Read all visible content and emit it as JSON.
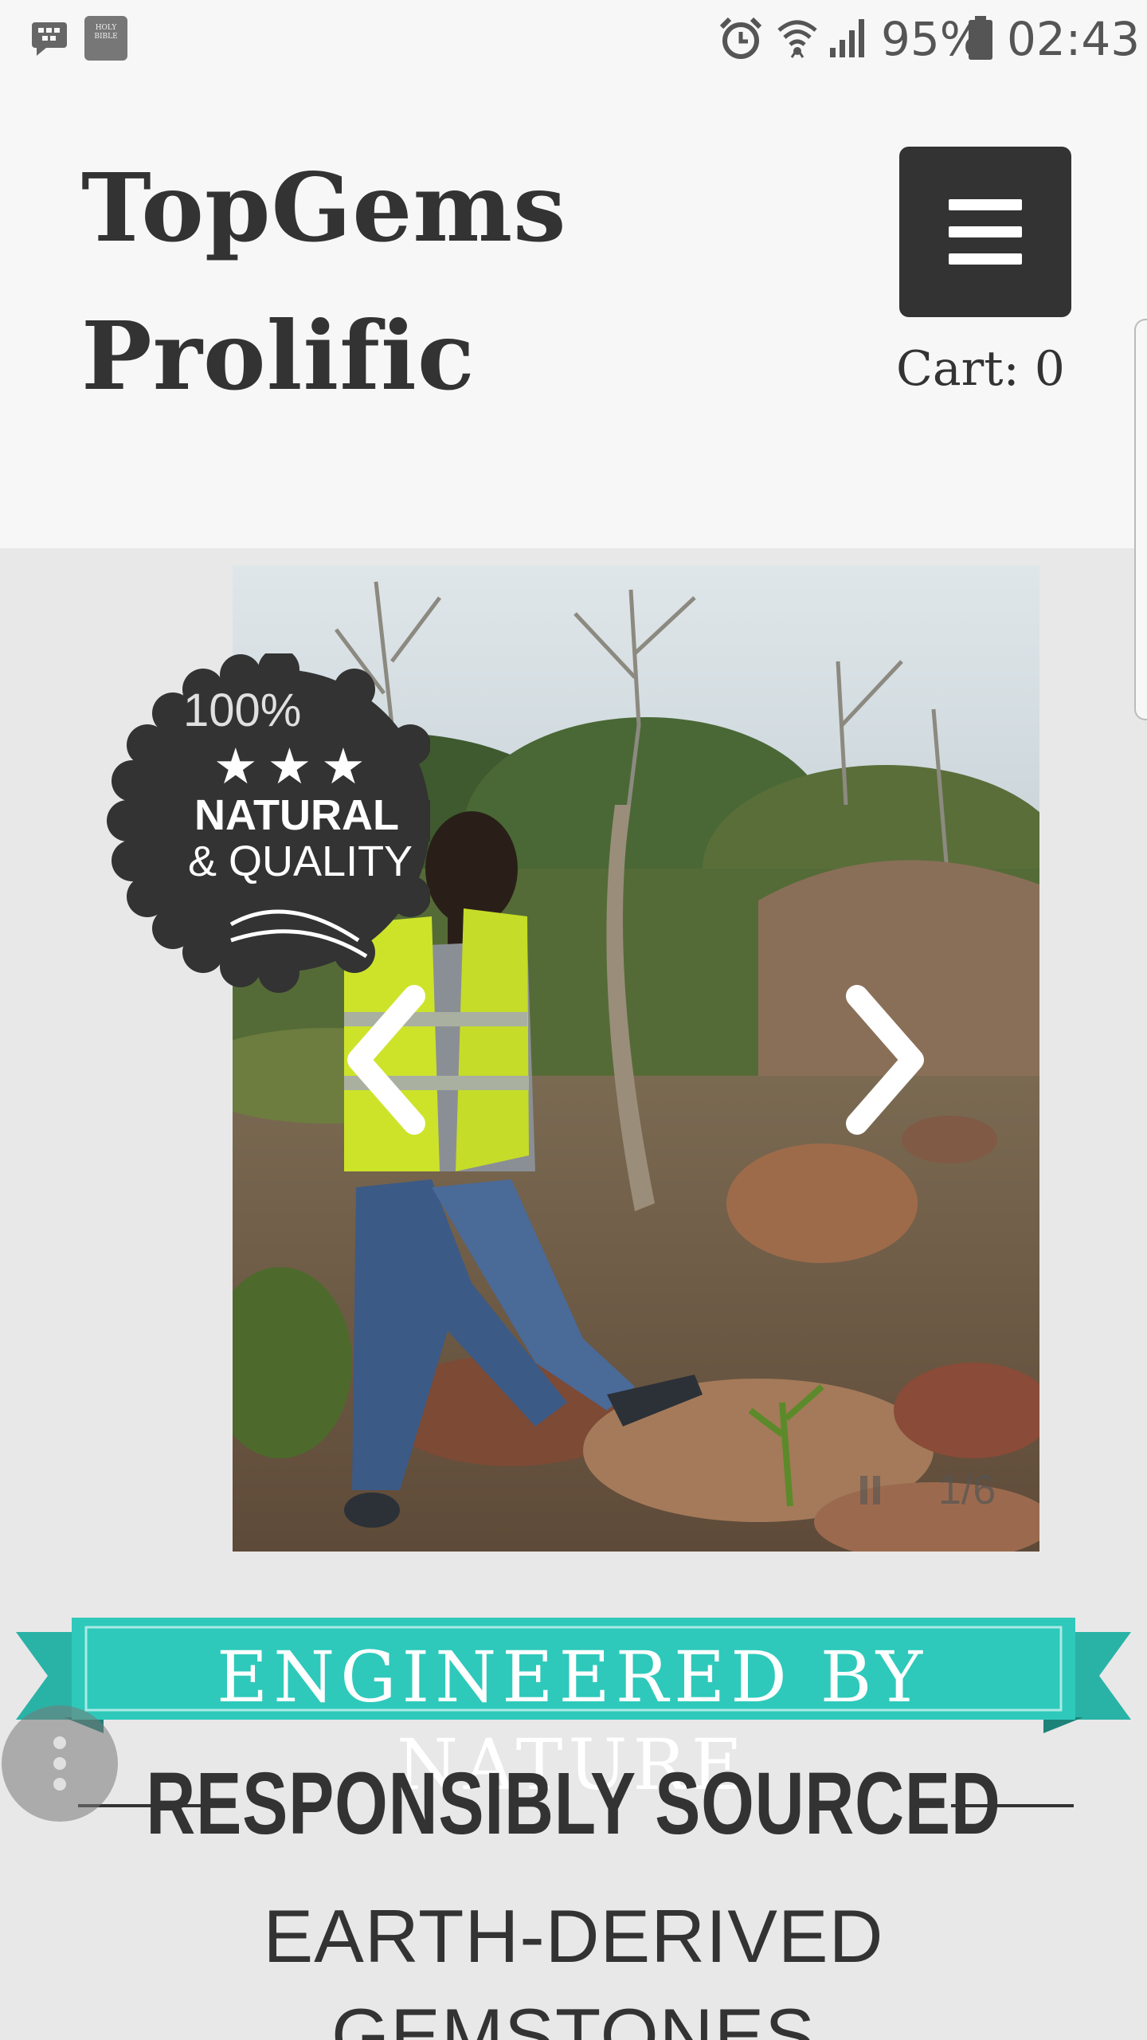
{
  "status_bar": {
    "battery": "95%",
    "time": "02:43",
    "icons": [
      "bbm-icon",
      "bible-app-icon",
      "alarm-icon",
      "wifi-icon",
      "signal-icon",
      "battery-icon"
    ],
    "bible_icon_text": "HOLY BIBLE"
  },
  "header": {
    "title": "TopGems Prolific",
    "cart": "Cart: 0",
    "menu_icon": "hamburger-icon"
  },
  "slideshow": {
    "counter": "1/6",
    "prev_icon": "chevron-left-icon",
    "next_icon": "chevron-right-icon",
    "pause_icon": "pause-icon"
  },
  "badge": {
    "percent": "100%",
    "stars": "★★★",
    "line1": "NATURAL",
    "line2": "& QUALITY"
  },
  "ribbon": {
    "text": "ENGINEERED BY NATURE"
  },
  "section": {
    "heading": "RESPONSIBLY SOURCED",
    "subheading_line1": "EARTH-DERIVED",
    "subheading_line2": "GEMSTONES"
  },
  "colors": {
    "teal": "#2ec9bb",
    "dark": "#333333",
    "background": "#e8e8e8",
    "header_bg": "#f7f7f7"
  }
}
